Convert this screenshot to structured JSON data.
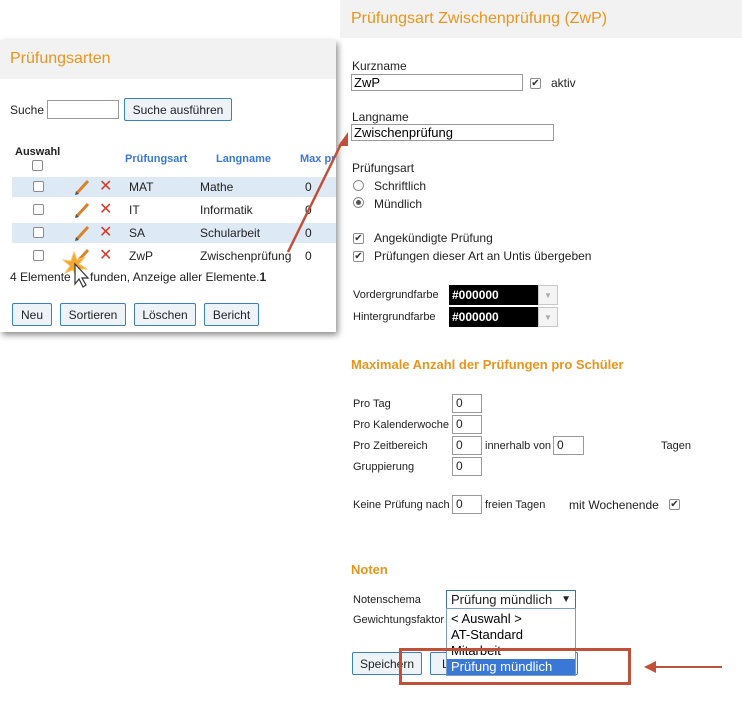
{
  "list_panel": {
    "title": "Prüfungsarten",
    "search_label": "Suche",
    "search_value": "",
    "search_button": "Suche ausführen",
    "columns": {
      "select": "Auswahl",
      "type": "Prüfungsart",
      "longname": "Langname",
      "max": "Max pr"
    },
    "rows": [
      {
        "short": "MAT",
        "long": "Mathe",
        "max": "0"
      },
      {
        "short": "IT",
        "long": "Informatik",
        "max": "0"
      },
      {
        "short": "SA",
        "long": "Schularbeit",
        "max": "0"
      },
      {
        "short": "ZwP",
        "long": "Zwischenprüfung",
        "max": "0"
      }
    ],
    "status_prefix": "4 Elemente ",
    "status_rest": "funden, Anzeige aller Elemente.",
    "status_count": "1",
    "buttons": [
      "Neu",
      "Sortieren",
      "Löschen",
      "Bericht"
    ]
  },
  "detail": {
    "title": "Prüfungsart Zwischenprüfung (ZwP)",
    "kurzname_label": "Kurzname",
    "kurzname_value": "ZwP",
    "aktiv_label": "aktiv",
    "aktiv_checked": true,
    "langname_label": "Langname",
    "langname_value": "Zwischenprüfung",
    "pruefungsart_label": "Prüfungsart",
    "radio_options": [
      "Schriftlich",
      "Mündlich"
    ],
    "radio_selected": "Mündlich",
    "checkbox_angekuendigt": "Angekündigte Prüfung",
    "checkbox_untis": "Prüfungen dieser Art an Untis übergeben",
    "vordergrund_label": "Vordergrundfarbe",
    "vordergrund_value": "#000000",
    "hintergrund_label": "Hintergrundfarbe",
    "hintergrund_value": "#000000",
    "max_section_title": "Maximale Anzahl der Prüfungen pro Schüler",
    "pro_tag_label": "Pro Tag",
    "pro_tag_value": "0",
    "pro_woche_label": "Pro Kalenderwoche",
    "pro_woche_value": "0",
    "pro_zeitbereich_label": "Pro Zeitbereich",
    "pro_zeitbereich_value": "0",
    "innerhalb_label": "innerhalb von",
    "innerhalb_value": "0",
    "tagen_label": "Tagen",
    "gruppierung_label": "Gruppierung",
    "gruppierung_value": "0",
    "keine_pruefung_label": "Keine Prüfung nach",
    "keine_pruefung_value": "0",
    "freien_tagen_label": "freien Tagen",
    "wochenende_label": "mit Wochenende",
    "noten_section_title": "Noten",
    "notenschema_label": "Notenschema",
    "notenschema_value": "Prüfung mündlich",
    "gewichtung_label": "Gewichtungsfaktor",
    "dropdown_options": [
      "< Auswahl >",
      "AT-Standard",
      "Mitarbeit",
      "Prüfung mündlich"
    ],
    "dropdown_selected": "Prüfung mündlich",
    "save_button": "Speichern",
    "second_button": "L"
  },
  "colors": {
    "accent_orange": "#e8951e",
    "link_blue": "#3a78d6",
    "annotation_red": "#c0503a",
    "highlight_blue": "#3a78d6"
  }
}
